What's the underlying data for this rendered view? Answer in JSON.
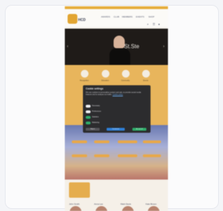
{
  "header": {
    "logo_text": "HCD",
    "nav_items": [
      "AWARDS",
      "CLUB",
      "MEMBERS",
      "EVENTS",
      "SHOP"
    ],
    "icons": [
      "search-icon",
      "menu-icon"
    ]
  },
  "hero": {
    "title": "St.Ste",
    "prev_icon": "‹",
    "next_icon": "›"
  },
  "features": [
    {
      "label": "Recognition"
    },
    {
      "label": "Education"
    },
    {
      "label": "Community"
    },
    {
      "label": "Events"
    }
  ],
  "cookie_modal": {
    "title": "Cookie settings",
    "text": "We use cookies to personalise content and ads, to provide social media features and to analyse our traffic.",
    "link": "Cookie policy",
    "options": [
      {
        "label": "Necessary",
        "enabled": true
      },
      {
        "label": "Preferences",
        "enabled": true
      },
      {
        "label": "Statistics",
        "enabled": true
      },
      {
        "label": "Marketing",
        "enabled": true
      }
    ],
    "buttons": {
      "reject": "Reject",
      "customize": "Customize",
      "accept": "Accept all"
    }
  },
  "members": [
    {
      "name": "John Smith"
    },
    {
      "name": "Anna Lee"
    },
    {
      "name": "Mark Davis"
    },
    {
      "name": "Kate Brown"
    }
  ],
  "colors": {
    "accent": "#e8b55c",
    "header_strip": "#e5ad3c",
    "modal_bg": "#2c2c2e",
    "toggle_on": "#2fae6a",
    "button_blue": "#2f7fd6",
    "button_green": "#2fae6a"
  }
}
